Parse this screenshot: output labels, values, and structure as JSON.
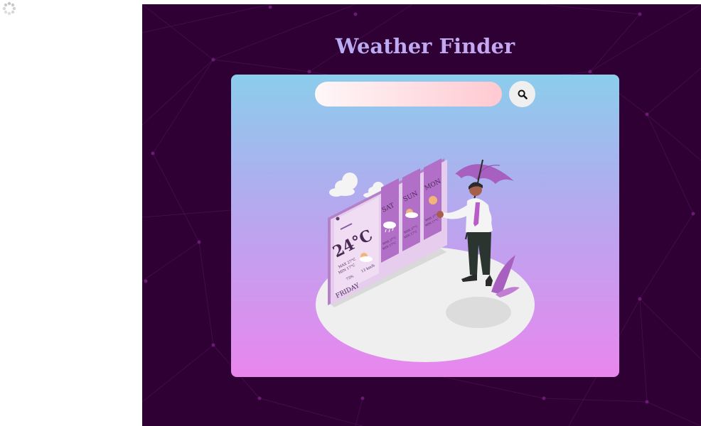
{
  "app": {
    "title": "Weather Finder"
  },
  "search": {
    "value": "",
    "placeholder": "",
    "button_icon": "search-icon"
  },
  "illustration": {
    "current_temp": "24°C",
    "day": "FRIDAY",
    "max_line": "MAX 27°C",
    "min_line": "MIN 17°C",
    "humidity": "75%",
    "wind": "13 km/h",
    "forecast": [
      {
        "day": "SAT",
        "icon": "rain-cloud-icon",
        "max": "MAX 27°C",
        "min": "MIN 17°C"
      },
      {
        "day": "SUN",
        "icon": "sun-cloud-icon",
        "max": "MAX 27°C",
        "min": "MIN 17°C"
      },
      {
        "day": "MON",
        "icon": "sun-icon",
        "max": "MAX 27°C",
        "min": "MIN 17°C"
      }
    ]
  },
  "colors": {
    "background": "#2e0033",
    "card_top": "#8bcdec",
    "card_bottom": "#e986ee",
    "title_gradient_start": "#a6b3f3",
    "title_gradient_end": "#d99ef0",
    "accent_purple": "#a24dbd"
  }
}
